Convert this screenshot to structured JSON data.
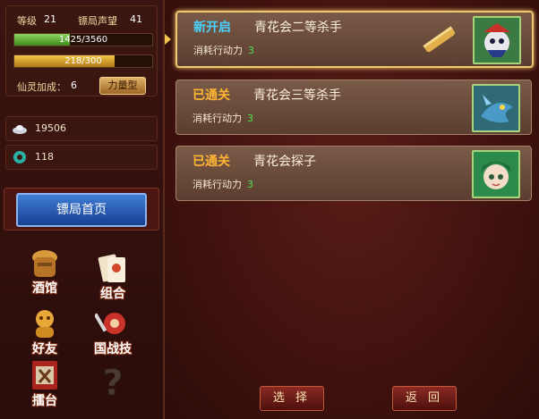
{
  "stats": {
    "level_label": "等级",
    "level": "21",
    "rep_label": "镖局声望",
    "rep": "41",
    "exp_text": "1425/3560",
    "exp_fraction": 0.4,
    "hp_text": "218/300",
    "hp_fraction": 0.727,
    "bonus_label": "仙灵加成：",
    "bonus_value": "6",
    "type_button": "力量型"
  },
  "resources": {
    "silver": "19506",
    "jade": "118"
  },
  "home_button": "镖局首页",
  "menu": [
    {
      "label": "酒馆",
      "icon": "tavern-icon"
    },
    {
      "label": "组合",
      "icon": "combo-cards-icon"
    },
    {
      "label": "好友",
      "icon": "friends-icon"
    },
    {
      "label": "国战技",
      "icon": "war-skill-icon"
    },
    {
      "label": "擂台",
      "icon": "arena-icon"
    },
    {
      "label": "",
      "icon": "question-mark-icon"
    }
  ],
  "quests": [
    {
      "status": "新开启",
      "status_color": "#49d2ff",
      "name": "青花会二等杀手",
      "cost_label": "消耗行动力",
      "cost": "3",
      "selected": true
    },
    {
      "status": "已通关",
      "status_color": "#ffb533",
      "name": "青花会三等杀手",
      "cost_label": "消耗行动力",
      "cost": "3",
      "selected": false
    },
    {
      "status": "已通关",
      "status_color": "#ffb533",
      "name": "青花会探子",
      "cost_label": "消耗行动力",
      "cost": "3",
      "selected": false
    }
  ],
  "buttons": {
    "select": "选 择",
    "back": "返 回"
  }
}
